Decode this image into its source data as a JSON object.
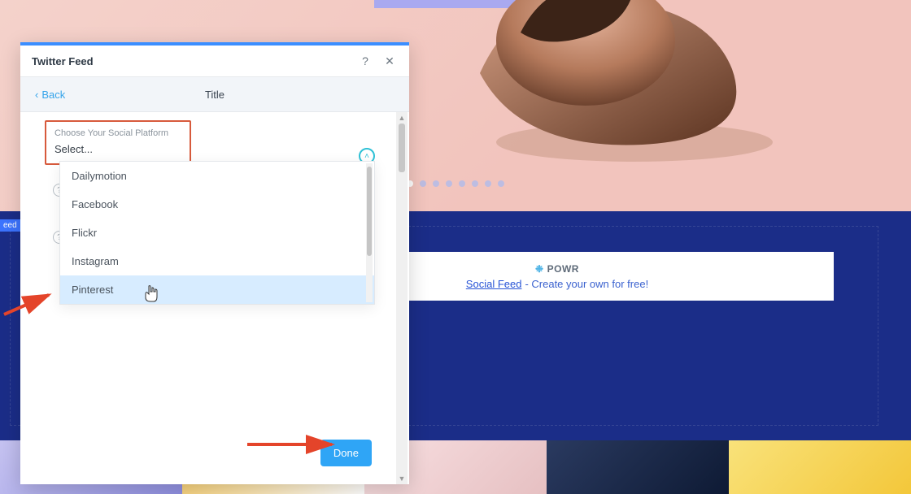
{
  "panel": {
    "title": "Twitter Feed",
    "help_tooltip": "?",
    "close_tooltip": "✕",
    "back_label": "Back",
    "section_title": "Title",
    "select": {
      "label": "Choose Your Social Platform",
      "value": "Select...",
      "options": [
        "Dailymotion",
        "Facebook",
        "Flickr",
        "Instagram",
        "Pinterest"
      ],
      "hovered_index": 4
    },
    "done_label": "Done"
  },
  "hero": {
    "dots_total": 8,
    "dots_active_index": 0
  },
  "blue_band": {
    "feed_label": "eed"
  },
  "powr": {
    "brand": "POWR",
    "link_text": "Social Feed",
    "tail_text": " - Create your own for free!"
  }
}
